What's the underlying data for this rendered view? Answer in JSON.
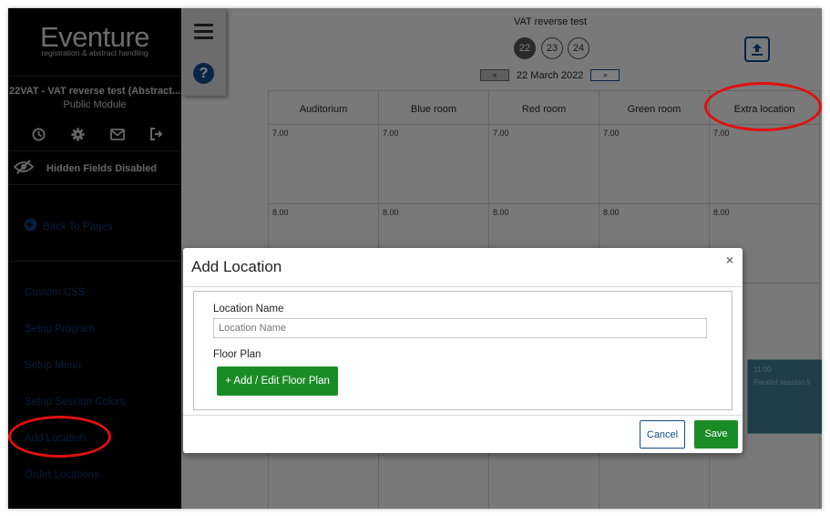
{
  "sidebar": {
    "logo_title": "Eventure",
    "logo_subtitle": "registration & abstract handling",
    "module_name": "22VAT - VAT reverse test (Abstract...",
    "module_type": "Public Module",
    "hidden_fields": "Hidden Fields Disabled",
    "back_to_pages": "Back To Pages",
    "menu": [
      "Custom CSS",
      "Setup Program",
      "Setup Menu",
      "Setup Session Colors",
      "Add Location",
      "Order Locations"
    ]
  },
  "header": {
    "event_title": "VAT reverse test",
    "days": [
      "22",
      "23",
      "24"
    ],
    "active_day": "22",
    "date": "22 March 2022",
    "prev_label": "«",
    "next_label": "»"
  },
  "grid": {
    "rooms": [
      "Auditorium",
      "Blue room",
      "Red room",
      "Green room",
      "Extra location"
    ],
    "times": [
      "7.00",
      "8.00"
    ],
    "session": {
      "time": "11:00",
      "title": "Parallel session 5"
    }
  },
  "modal": {
    "title": "Add Location",
    "close": "×",
    "location_label": "Location Name",
    "location_placeholder": "Location Name",
    "floor_plan_label": "Floor Plan",
    "floor_plan_button": "+ Add / Edit Floor Plan",
    "cancel": "Cancel",
    "save": "Save"
  },
  "colors": {
    "sidebar_bg": "#000000",
    "link_blue": "#0d3a78",
    "primary_green": "#1a8c26",
    "annotation_red": "#e01010"
  }
}
